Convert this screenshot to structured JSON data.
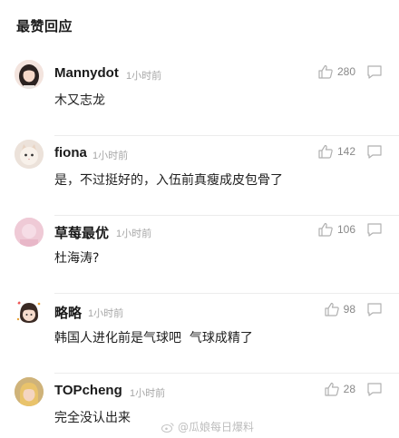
{
  "section": {
    "title": "最赞回应"
  },
  "comments": [
    {
      "user": "Mannydot",
      "time": "1小时前",
      "text": "木又志龙",
      "likes": "280",
      "avatar_icon": "avatar-girl-dark-hair"
    },
    {
      "user": "fiona",
      "time": "1小时前",
      "text": "是，不过挺好的，入伍前真瘦成皮包骨了",
      "likes": "142",
      "avatar_icon": "avatar-cat"
    },
    {
      "user": "草莓最优",
      "time": "1小时前",
      "text": "杜海涛?",
      "likes": "106",
      "avatar_icon": "avatar-pink"
    },
    {
      "user": "略略",
      "time": "1小时前",
      "text": "韩国人进化前是气球吧  气球成精了",
      "likes": "98",
      "avatar_icon": "avatar-cartoon-girl"
    },
    {
      "user": "TOPcheng",
      "time": "1小时前",
      "text": "完全没认出来",
      "likes": "28",
      "avatar_icon": "avatar-blonde"
    }
  ],
  "watermark": {
    "text": "@瓜娘每日爆料",
    "icon": "weibo-icon"
  },
  "colors": {
    "divider": "#ececec",
    "meta": "#a7a7a7",
    "icon": "#b0b0b0"
  }
}
